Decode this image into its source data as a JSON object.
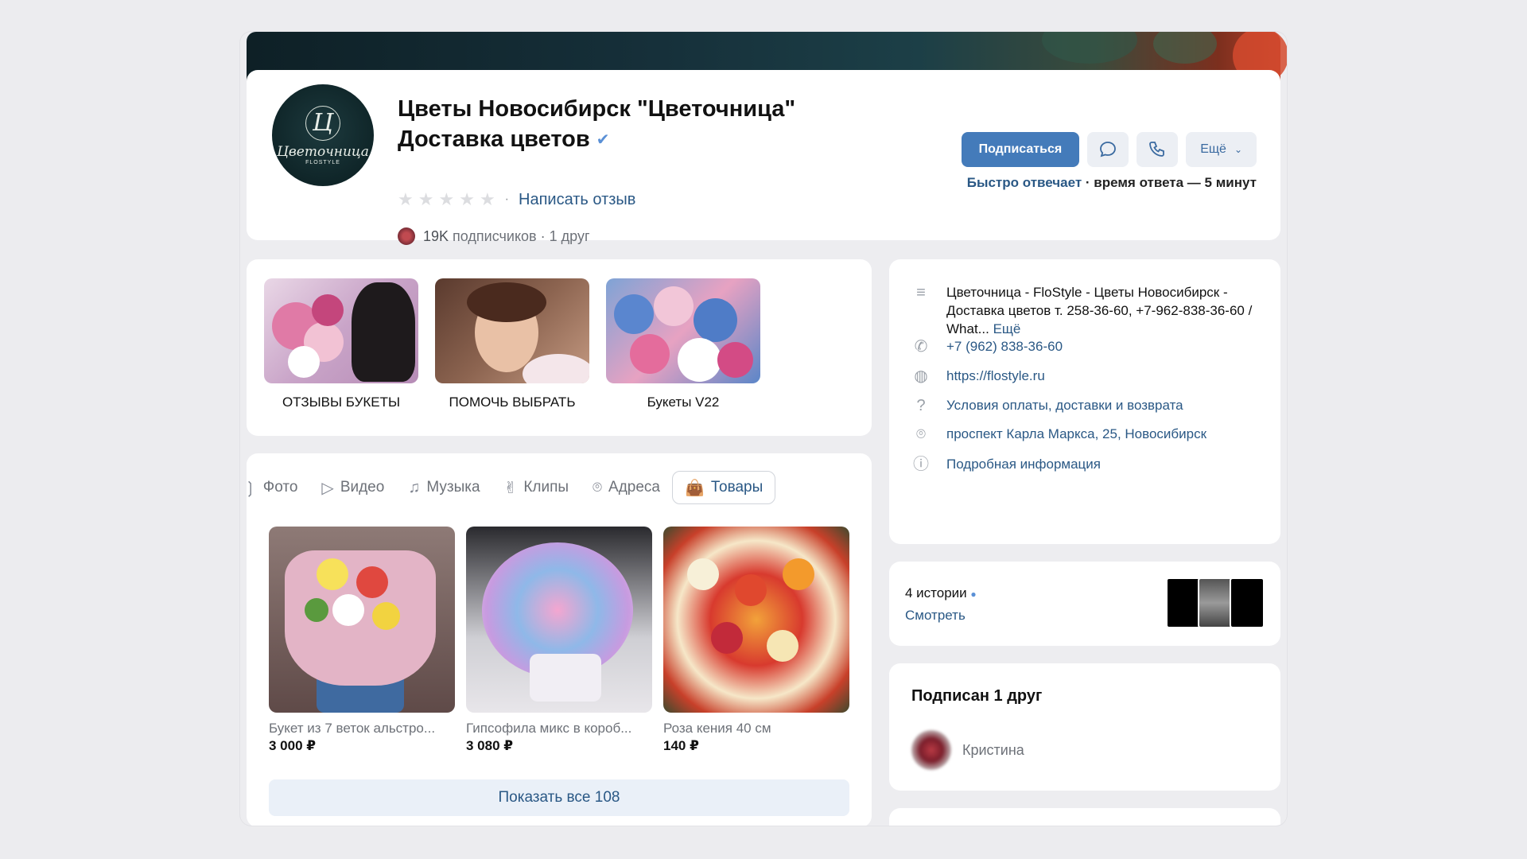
{
  "community": {
    "title_line1": "Цветы Новосибирск \"Цветочница\"",
    "title_line2": "Доставка цветов",
    "verified_icon": "check-icon",
    "write_review": "Написать отзыв",
    "subscribers": "19K",
    "subscribers_label": "подписчиков",
    "friends": "· 1 друг",
    "avatar_mono": "Ц",
    "avatar_script": "Цветочница",
    "avatar_small": "FLOSTYLE"
  },
  "actions": {
    "subscribe": "Подписаться",
    "more": "Ещё",
    "reply_fast": "Быстро отвечает",
    "reply_time": "время ответа — 5 минут"
  },
  "albums": [
    {
      "caption": "ОТЗЫВЫ БУКЕТЫ"
    },
    {
      "caption": "ПОМОЧЬ ВЫБРАТЬ"
    },
    {
      "caption": "Букеты V22"
    }
  ],
  "tabs": [
    {
      "label": "Фото",
      "icon": "photo-icon"
    },
    {
      "label": "Видео",
      "icon": "video-icon"
    },
    {
      "label": "Музыка",
      "icon": "music-icon"
    },
    {
      "label": "Клипы",
      "icon": "clips-icon"
    },
    {
      "label": "Адреса",
      "icon": "location-icon"
    },
    {
      "label": "Товары",
      "icon": "bag-icon",
      "active": true
    }
  ],
  "goods": [
    {
      "name": "Букет из 7 веток альстро...",
      "price": "3 000 ₽"
    },
    {
      "name": "Гипсофила микс в короб...",
      "price": "3 080 ₽"
    },
    {
      "name": "Роза кения 40 см",
      "price": "140 ₽"
    }
  ],
  "show_all": "Показать все 108",
  "info": {
    "description": "Цветочница - FloStyle - Цветы Новосибирск - Доставка цветов т. 258-36-60, +7-962-838-36-60 / What...",
    "description_more": "Ещё",
    "phone": "+7 (962) 838-36-60",
    "site": "https://flostyle.ru",
    "terms": "Условия оплаты, доставки и возврата",
    "address": "проспект Карла Маркса, 25, Новосибирск",
    "details": "Подробная информация"
  },
  "stories": {
    "count": "4 истории",
    "watch": "Смотреть"
  },
  "friends_block": {
    "heading": "Подписан 1 друг",
    "friend_name": "Кристина"
  },
  "colors": {
    "accent": "#447bba",
    "link": "#2a5885",
    "background": "#ececef"
  }
}
